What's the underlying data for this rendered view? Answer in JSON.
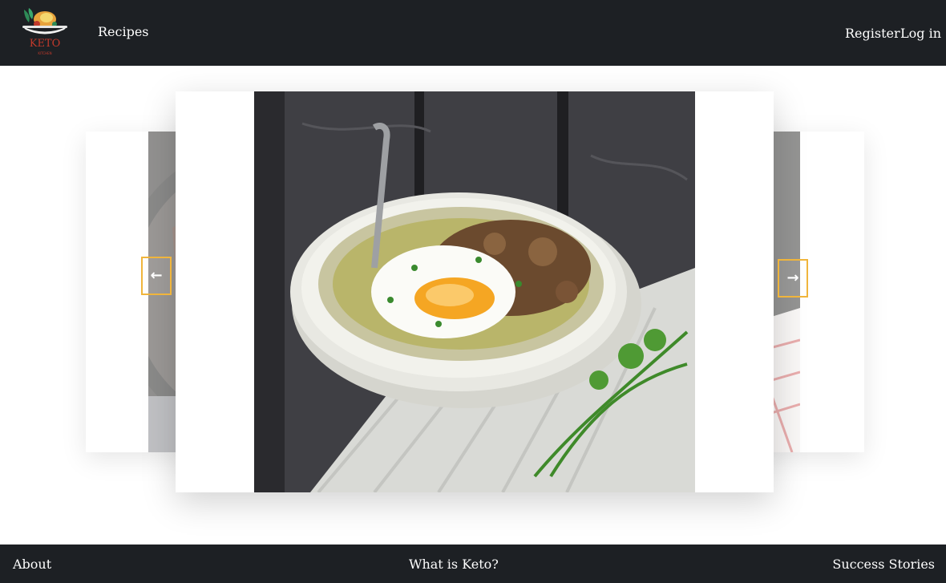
{
  "header": {
    "logo_text": "Keto",
    "logo_subtext": "KITCHEN",
    "recipes_label": "Recipes",
    "register_label": "Register",
    "login_label": "Log in"
  },
  "carousel": {
    "prev_arrow": "arrow-left-icon",
    "next_arrow": "arrow-right-icon",
    "prev_glyph": "←",
    "next_glyph": "→",
    "accent_color": "#f0b53c"
  },
  "footer": {
    "about_label": "About",
    "what_is_keto_label": "What is Keto?",
    "success_stories_label": "Success Stories"
  },
  "colors": {
    "bar_background": "#1d2024",
    "logo_red": "#c0392b"
  }
}
